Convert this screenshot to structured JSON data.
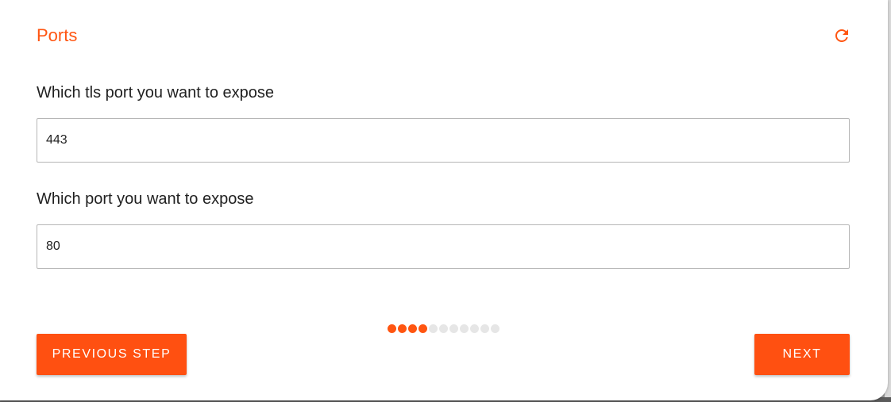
{
  "dialog": {
    "title": "Ports",
    "refresh_icon": "refresh-icon"
  },
  "fields": {
    "tls_port": {
      "label": "Which tls port you want to expose",
      "value": "443"
    },
    "port": {
      "label": "Which port you want to expose",
      "value": "80"
    }
  },
  "stepper": {
    "total_steps": 11,
    "completed_steps": 4
  },
  "buttons": {
    "previous_label": "PREVIOUS STEP",
    "next_label": "NEXT"
  },
  "colors": {
    "accent": "#ff5511",
    "inactive_dot": "#e6e6e6"
  }
}
